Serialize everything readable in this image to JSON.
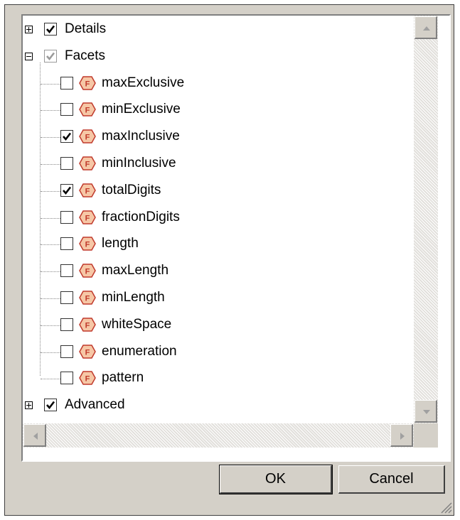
{
  "tree": {
    "groups": [
      {
        "label": "Details",
        "expanded": false,
        "checked": true,
        "disabled": false
      },
      {
        "label": "Facets",
        "expanded": true,
        "checked": true,
        "disabled": true
      },
      {
        "label": "Advanced",
        "expanded": false,
        "checked": true,
        "disabled": false
      }
    ],
    "facets": [
      {
        "label": "maxExclusive",
        "checked": false
      },
      {
        "label": "minExclusive",
        "checked": false
      },
      {
        "label": "maxInclusive",
        "checked": true
      },
      {
        "label": "minInclusive",
        "checked": false
      },
      {
        "label": "totalDigits",
        "checked": true
      },
      {
        "label": "fractionDigits",
        "checked": false
      },
      {
        "label": "length",
        "checked": false
      },
      {
        "label": "maxLength",
        "checked": false
      },
      {
        "label": "minLength",
        "checked": false
      },
      {
        "label": "whiteSpace",
        "checked": false
      },
      {
        "label": "enumeration",
        "checked": false
      },
      {
        "label": "pattern",
        "checked": false
      }
    ],
    "facet_icon_letter": "F",
    "facet_icon_name": "facet-icon"
  },
  "buttons": {
    "ok_label": "OK",
    "cancel_label": "Cancel"
  },
  "colors": {
    "dialog_bg": "#d4d0c8",
    "facet_icon_fill": "#f6c7a6",
    "facet_icon_stroke": "#c0392b"
  }
}
